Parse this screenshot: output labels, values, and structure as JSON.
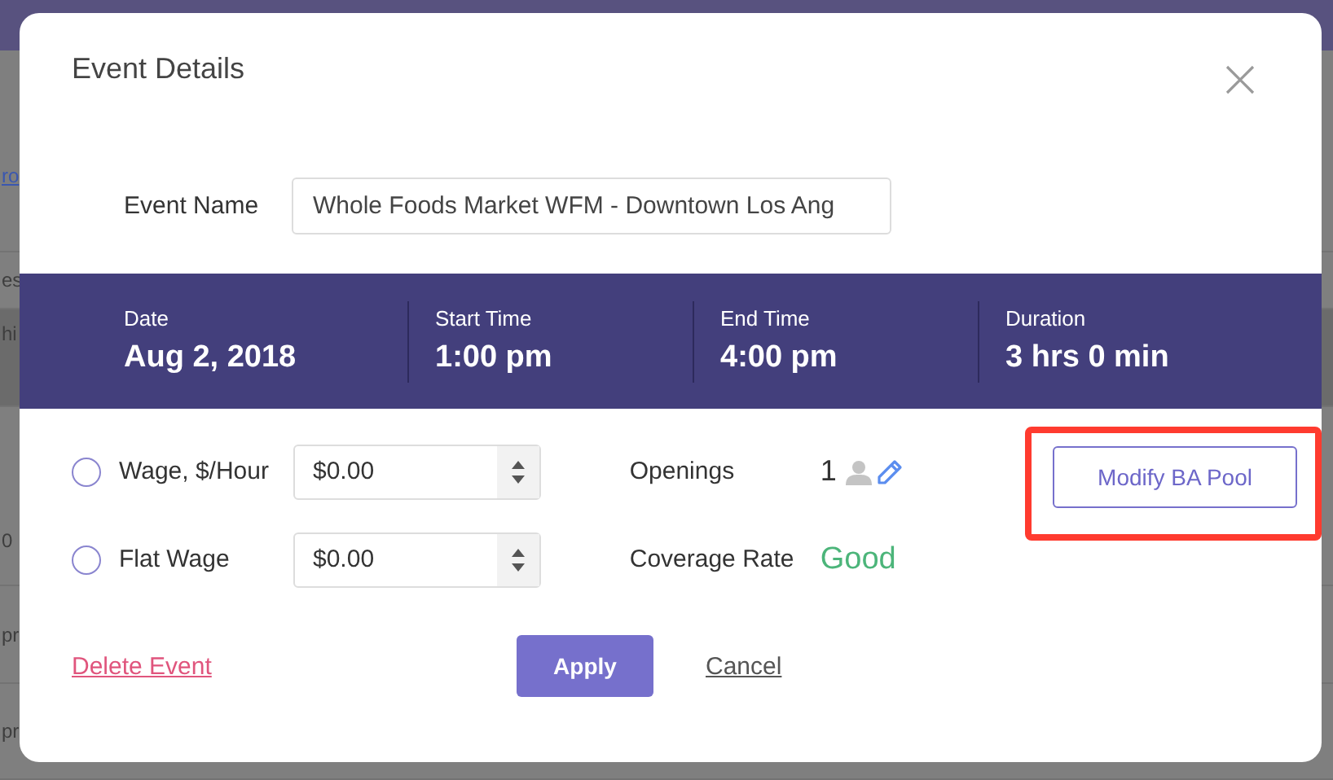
{
  "background_page": {
    "fragments": [
      {
        "text": "ro",
        "kind": "link"
      },
      {
        "text": "es",
        "kind": "label"
      },
      {
        "text": "hi",
        "kind": "bar"
      },
      {
        "text": "0",
        "kind": "cell"
      },
      {
        "text": "pr",
        "kind": "cell"
      },
      {
        "text": "pr",
        "kind": "cell"
      }
    ]
  },
  "dialog": {
    "title": "Event Details",
    "event_name": {
      "label": "Event Name",
      "value": "Whole Foods Market WFM - Downtown Los Ang"
    },
    "summary": [
      {
        "label": "Date",
        "value": "Aug 2, 2018"
      },
      {
        "label": "Start Time",
        "value": "1:00 pm"
      },
      {
        "label": "End Time",
        "value": "4:00 pm"
      },
      {
        "label": "Duration",
        "value": "3 hrs 0 min"
      }
    ],
    "wage_options": [
      {
        "label": "Wage, $/Hour",
        "selected": false,
        "value": "$0.00"
      },
      {
        "label": "Flat Wage",
        "selected": false,
        "value": "$0.00"
      }
    ],
    "openings": {
      "label": "Openings",
      "value": "1"
    },
    "coverage_rate": {
      "label": "Coverage Rate",
      "value": "Good"
    },
    "modify_button": {
      "label": "Modify BA Pool",
      "highlighted": true
    },
    "delete_link": "Delete Event",
    "apply_button": "Apply",
    "cancel_link": "Cancel"
  }
}
